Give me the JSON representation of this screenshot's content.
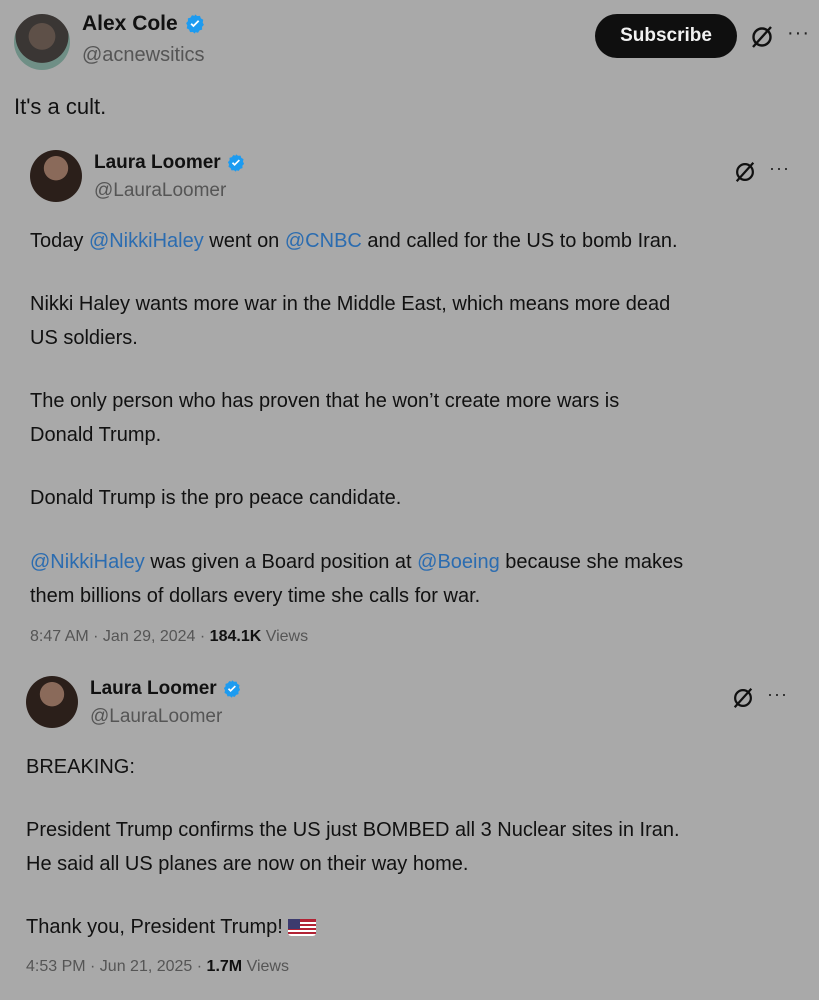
{
  "header": {
    "name": "Alex Cole",
    "handle": "@acnewsitics",
    "subscribe_label": "Subscribe",
    "more_label": "···",
    "tweet_text": "It's a cult."
  },
  "quote1": {
    "name": "Laura Loomer",
    "handle": "@LauraLoomer",
    "more_label": "···",
    "line1": {
      "a": "Today ",
      "m1": "@NikkiHaley",
      "b": " went on ",
      "m2": "@CNBC",
      "c": " and called for the US to bomb Iran."
    },
    "para2": "Nikki Haley wants more war in the Middle East, which means more dead\nUS soldiers.",
    "para3": "The only person who has proven that he won’t create more wars is\nDonald Trump.",
    "para4": "Donald Trump is the pro peace candidate.",
    "para5": {
      "m1": "@NikkiHaley",
      "a": " was given a Board position at ",
      "m2": "@Boeing",
      "b": " because she makes\nthem billions of dollars every time she calls for war."
    },
    "time": "8:47 AM · Jan 29, 2024 · ",
    "views_count": "184.1K",
    "views_label": " Views"
  },
  "quote2": {
    "name": "Laura Loomer",
    "handle": "@LauraLoomer",
    "more_label": "···",
    "para1": "BREAKING:",
    "para2": "President Trump confirms the US just BOMBED all 3 Nuclear sites in Iran.\nHe said all US planes are now on their way home.",
    "para3": "Thank you, President Trump! ",
    "time": "4:53 PM · Jun 21, 2025 · ",
    "views_count": "1.7M",
    "views_label": " Views"
  },
  "colors": {
    "verified": "#1d9bf0",
    "mention": "#2b6cb0",
    "background": "#a9a9a9"
  },
  "icons": [
    "verified-badge-icon",
    "grok-icon",
    "more-icon",
    "us-flag-icon"
  ]
}
